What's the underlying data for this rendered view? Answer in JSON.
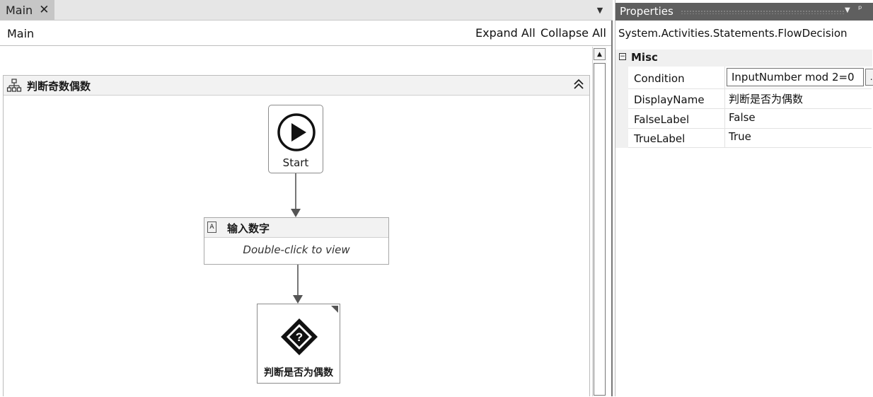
{
  "tabs": [
    {
      "label": "Main",
      "close_glyph": "✕",
      "active": true
    }
  ],
  "designer": {
    "breadcrumb": "Main",
    "expand_all": "Expand All",
    "collapse_all": "Collapse All"
  },
  "flowchart": {
    "title": "判断奇数偶数",
    "icon": "flowchart-icon",
    "start_label": "Start",
    "activity": {
      "title": "输入数字",
      "body": "Double-click to view",
      "icon": "assign-activity-icon"
    },
    "decision": {
      "label": "判断是否为偶数",
      "icon": "decision-question-icon"
    }
  },
  "properties": {
    "title": "Properties",
    "type_name": "System.Activities.Statements.FlowDecision",
    "category": "Misc",
    "rows": [
      {
        "name": "Condition",
        "value": "InputNumber mod 2=0",
        "has_ellipsis": true
      },
      {
        "name": "DisplayName",
        "value": "判断是否为偶数"
      },
      {
        "name": "FalseLabel",
        "value": "False"
      },
      {
        "name": "TrueLabel",
        "value": "True"
      }
    ],
    "ellipsis_label": "..."
  }
}
